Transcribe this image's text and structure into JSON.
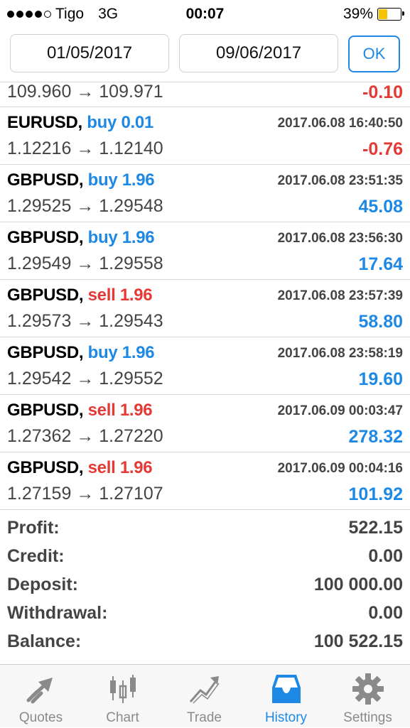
{
  "status_bar": {
    "carrier": "Tigo",
    "network": "3G",
    "time": "00:07",
    "battery_percent": "39%",
    "battery_level": 0.39,
    "signal_bars_filled": 4,
    "signal_bars_total": 5
  },
  "date_filter": {
    "from_date": "01/05/2017",
    "to_date": "09/06/2017",
    "ok_label": "OK"
  },
  "trades": [
    {
      "symbol": "",
      "side": "",
      "volume": "",
      "time": "",
      "open_price": "109.960",
      "close_price": "109.971",
      "arrow": "→",
      "profit": "-0.10"
    },
    {
      "symbol": "EURUSD,",
      "side": "buy",
      "volume": "0.01",
      "time": "2017.06.08 16:40:50",
      "open_price": "1.12216",
      "close_price": "1.12140",
      "arrow": "→",
      "profit": "-0.76"
    },
    {
      "symbol": "GBPUSD,",
      "side": "buy",
      "volume": "1.96",
      "time": "2017.06.08 23:51:35",
      "open_price": "1.29525",
      "close_price": "1.29548",
      "arrow": "→",
      "profit": "45.08"
    },
    {
      "symbol": "GBPUSD,",
      "side": "buy",
      "volume": "1.96",
      "time": "2017.06.08 23:56:30",
      "open_price": "1.29549",
      "close_price": "1.29558",
      "arrow": "→",
      "profit": "17.64"
    },
    {
      "symbol": "GBPUSD,",
      "side": "sell",
      "volume": "1.96",
      "time": "2017.06.08 23:57:39",
      "open_price": "1.29573",
      "close_price": "1.29543",
      "arrow": "→",
      "profit": "58.80"
    },
    {
      "symbol": "GBPUSD,",
      "side": "buy",
      "volume": "1.96",
      "time": "2017.06.08 23:58:19",
      "open_price": "1.29542",
      "close_price": "1.29552",
      "arrow": "→",
      "profit": "19.60"
    },
    {
      "symbol": "GBPUSD,",
      "side": "sell",
      "volume": "1.96",
      "time": "2017.06.09 00:03:47",
      "open_price": "1.27362",
      "close_price": "1.27220",
      "arrow": "→",
      "profit": "278.32"
    },
    {
      "symbol": "GBPUSD,",
      "side": "sell",
      "volume": "1.96",
      "time": "2017.06.09 00:04:16",
      "open_price": "1.27159",
      "close_price": "1.27107",
      "arrow": "→",
      "profit": "101.92"
    }
  ],
  "summary": {
    "profit_label": "Profit:",
    "profit_value": "522.15",
    "credit_label": "Credit:",
    "credit_value": "0.00",
    "deposit_label": "Deposit:",
    "deposit_value": "100 000.00",
    "withdrawal_label": "Withdrawal:",
    "withdrawal_value": "0.00",
    "balance_label": "Balance:",
    "balance_value": "100 522.15"
  },
  "tabs": [
    {
      "label": "Quotes",
      "icon": "quotes-icon",
      "active": false
    },
    {
      "label": "Chart",
      "icon": "chart-icon",
      "active": false
    },
    {
      "label": "Trade",
      "icon": "trade-icon",
      "active": false
    },
    {
      "label": "History",
      "icon": "history-icon",
      "active": true
    },
    {
      "label": "Settings",
      "icon": "gear-icon",
      "active": false
    }
  ],
  "colors": {
    "accent": "#1e88e5",
    "buy": "#1e88e5",
    "sell": "#e53935",
    "profit_positive": "#1e88e5",
    "profit_negative": "#e53935",
    "battery": "#f5c400",
    "inactive_tab": "#8a8a8a"
  }
}
